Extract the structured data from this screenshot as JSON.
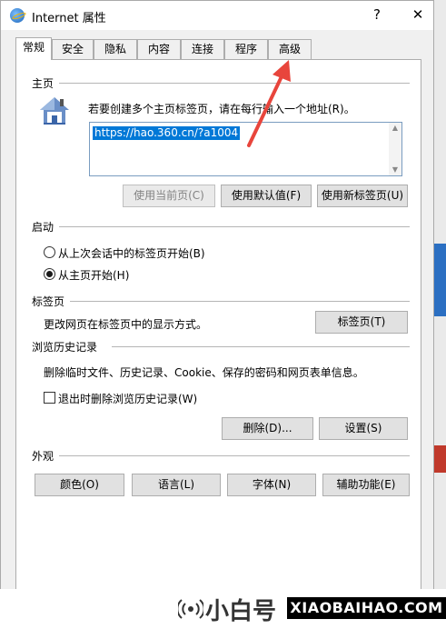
{
  "window": {
    "title": "Internet 属性",
    "help": "?",
    "close": "✕"
  },
  "tabs": [
    "常规",
    "安全",
    "隐私",
    "内容",
    "连接",
    "程序",
    "高级"
  ],
  "homepage": {
    "section": "主页",
    "description": "若要创建多个主页标签页，请在每行输入一个地址(R)。",
    "url": "https://hao.360.cn/?a1004",
    "btn_current": "使用当前页(C)",
    "btn_default": "使用默认值(F)",
    "btn_newtab": "使用新标签页(U)"
  },
  "startup": {
    "section": "启动",
    "option_last": "从上次会话中的标签页开始(B)",
    "option_home": "从主页开始(H)",
    "selected": "option_home"
  },
  "tabs_section": {
    "section": "标签页",
    "description": "更改网页在标签页中的显示方式。",
    "button": "标签页(T)"
  },
  "history": {
    "section": "浏览历史记录",
    "description": "删除临时文件、历史记录、Cookie、保存的密码和网页表单信息。",
    "checkbox": "退出时删除浏览历史记录(W)",
    "checked": false,
    "btn_delete": "删除(D)...",
    "btn_settings": "设置(S)"
  },
  "appearance": {
    "section": "外观",
    "btn_colors": "颜色(O)",
    "btn_languages": "语言(L)",
    "btn_fonts": "字体(N)",
    "btn_accessibility": "辅助功能(E)"
  },
  "watermark": {
    "name": "小白号",
    "domain": "XIAOBAIHAO.COM"
  },
  "colors": {
    "selection": "#0078d7",
    "arrow": "#e8453c"
  }
}
